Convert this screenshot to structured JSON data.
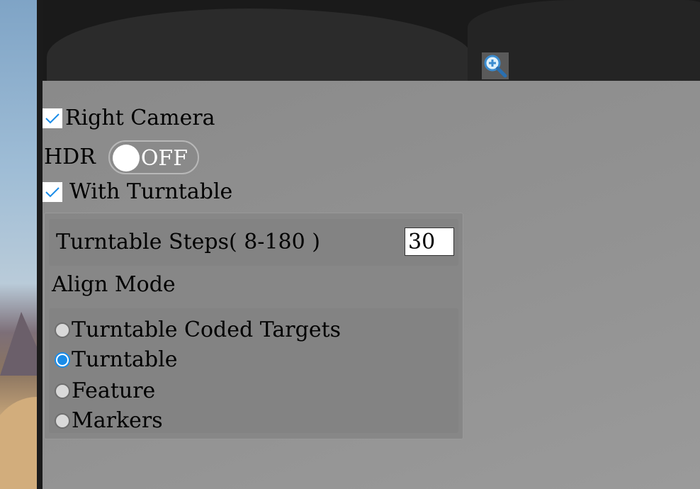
{
  "preview": {
    "zoom_icon": "zoom-in-icon"
  },
  "options": {
    "right_camera": {
      "label": "Right Camera",
      "checked": true
    },
    "hdr": {
      "label": "HDR",
      "toggle_text": "OFF",
      "on": false
    },
    "with_turntable": {
      "label": "With Turntable",
      "checked": true
    }
  },
  "turntable": {
    "steps_label": "Turntable Steps( 8-180 )",
    "steps_value": "30"
  },
  "align": {
    "title": "Align Mode",
    "options": [
      {
        "label": "Turntable Coded Targets",
        "selected": false
      },
      {
        "label": "Turntable",
        "selected": true
      },
      {
        "label": "Feature",
        "selected": false
      },
      {
        "label": "Markers",
        "selected": false
      }
    ]
  },
  "colors": {
    "accent": "#1a8ce8",
    "panel": "#8f8f8f"
  }
}
